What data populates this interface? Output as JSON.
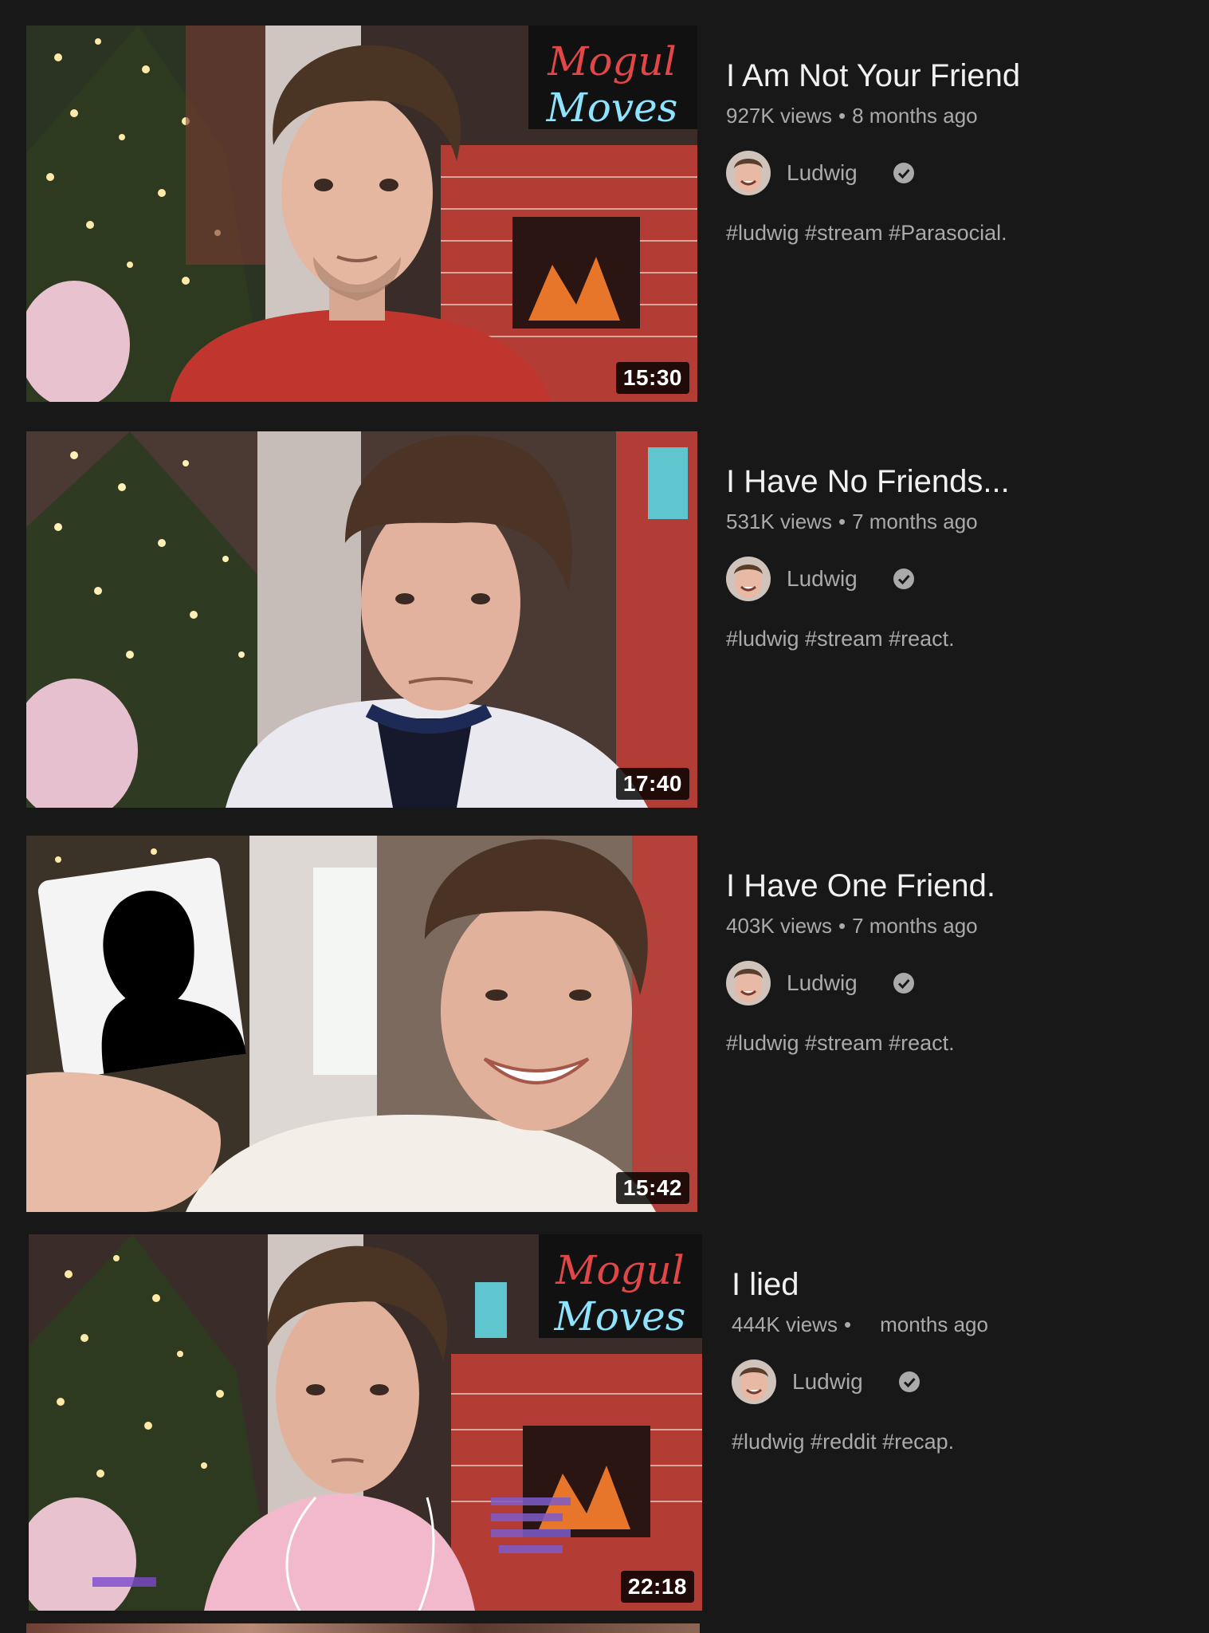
{
  "videos": [
    {
      "title": "I Am Not Your Friend",
      "views": "927K views",
      "age": "8 months ago",
      "channel": "Ludwig",
      "tags": "#ludwig #stream #Parasocial.",
      "duration": "15:30",
      "shirt_color": "#c0362e",
      "sign_line1": "Mogul",
      "sign_line2": "Moves"
    },
    {
      "title": "I Have No Friends...",
      "views": "531K views",
      "age": "7 months ago",
      "channel": "Ludwig",
      "tags": "#ludwig #stream #react.",
      "duration": "17:40",
      "shirt_color": "#e9e9ef"
    },
    {
      "title": "I Have One Friend.",
      "views": "403K views",
      "age": "7 months ago",
      "channel": "Ludwig",
      "tags": "#ludwig #stream #react.",
      "duration": "15:42",
      "shirt_color": "#f3efe8"
    },
    {
      "title": "I lied",
      "views": "444K views",
      "age": "months ago",
      "channel": "Ludwig",
      "tags": "#ludwig #reddit #recap.",
      "duration": "22:18",
      "shirt_color": "#f2b9cc",
      "sign_line1": "Mogul",
      "sign_line2": "Moves"
    }
  ],
  "colors": {
    "background": "#181818",
    "title": "#f1f1f1",
    "secondary": "#aaaaaa"
  },
  "icons": {
    "verified": "check-circle"
  }
}
